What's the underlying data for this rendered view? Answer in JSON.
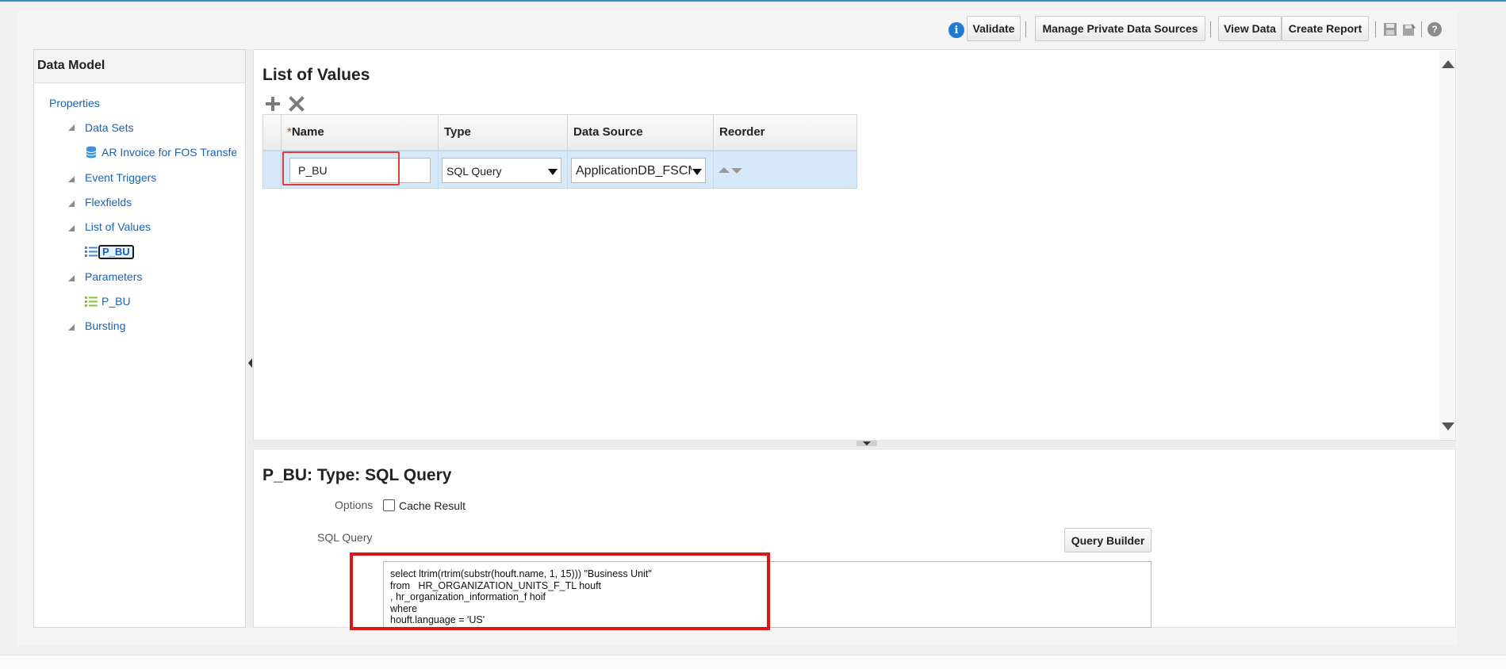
{
  "toolbar": {
    "validate": "Validate",
    "manage_private": "Manage Private Data Sources",
    "view_data": "View Data",
    "create_report": "Create Report",
    "info_icon": "i",
    "help_icon": "?"
  },
  "left_panel": {
    "title": "Data Model",
    "items": [
      {
        "label": "Properties"
      },
      {
        "label": "Data Sets"
      },
      {
        "label": "AR Invoice for FOS Transfer"
      },
      {
        "label": "Event Triggers"
      },
      {
        "label": "Flexfields"
      },
      {
        "label": "List of Values"
      },
      {
        "label": "P_BU"
      },
      {
        "label": "Parameters"
      },
      {
        "label": "P_BU"
      },
      {
        "label": "Bursting"
      }
    ]
  },
  "lov": {
    "title": "List of Values",
    "columns": {
      "required_mark": "*",
      "name": "Name",
      "type": "Type",
      "source": "Data Source",
      "reorder": "Reorder"
    },
    "row": {
      "name": "P_BU",
      "type": "SQL Query",
      "source": "ApplicationDB_FSCM"
    }
  },
  "detail": {
    "title": "P_BU: Type: SQL Query",
    "options_label": "Options",
    "cache_label": "Cache Result",
    "cache_checked": false,
    "sql_label": "SQL Query",
    "query_builder": "Query Builder",
    "sql_text": "select ltrim(rtrim(substr(houft.name, 1, 15))) \"Business Unit\"\nfrom   HR_ORGANIZATION_UNITS_F_TL houft\n, hr_organization_information_f hoif\nwhere\nhouft.language = 'US'"
  },
  "colors": {
    "accent": "#1a62b3",
    "highlight_red": "#e01616",
    "selected_row": "#d7e8f8"
  }
}
